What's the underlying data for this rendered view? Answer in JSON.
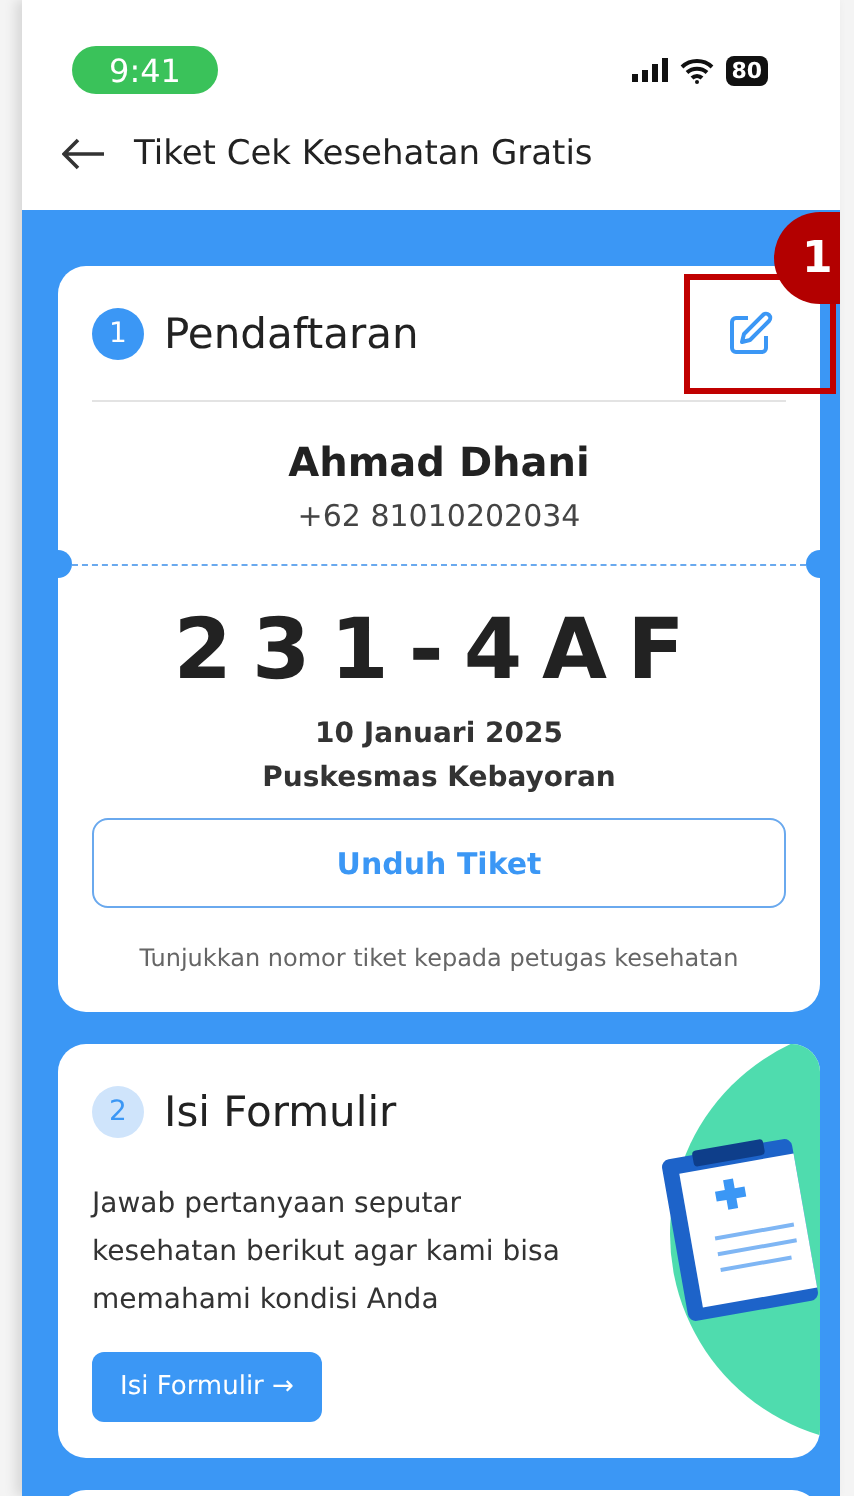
{
  "status_bar": {
    "time": "9:41",
    "battery": "80"
  },
  "header": {
    "title": "Tiket Cek Kesehatan Gratis"
  },
  "annotation": {
    "label": "1",
    "highlighted": true
  },
  "registration": {
    "step": "1",
    "active": true,
    "title": "Pendaftaran",
    "name": "Ahmad Dhani",
    "phone": "+62 81010202034",
    "ticket_code": "231-4AF",
    "date": "10 Januari 2025",
    "location": "Puskesmas Kebayoran",
    "download_button": "Unduh Tiket",
    "note": "Tunjukkan nomor tiket kepada petugas kesehatan"
  },
  "form": {
    "step": "2",
    "active": false,
    "title": "Isi Formulir",
    "description": "Jawab pertanyaan seputar kesehatan berikut agar kami bisa memahami kondisi Anda",
    "button": "Isi Formulir →"
  }
}
